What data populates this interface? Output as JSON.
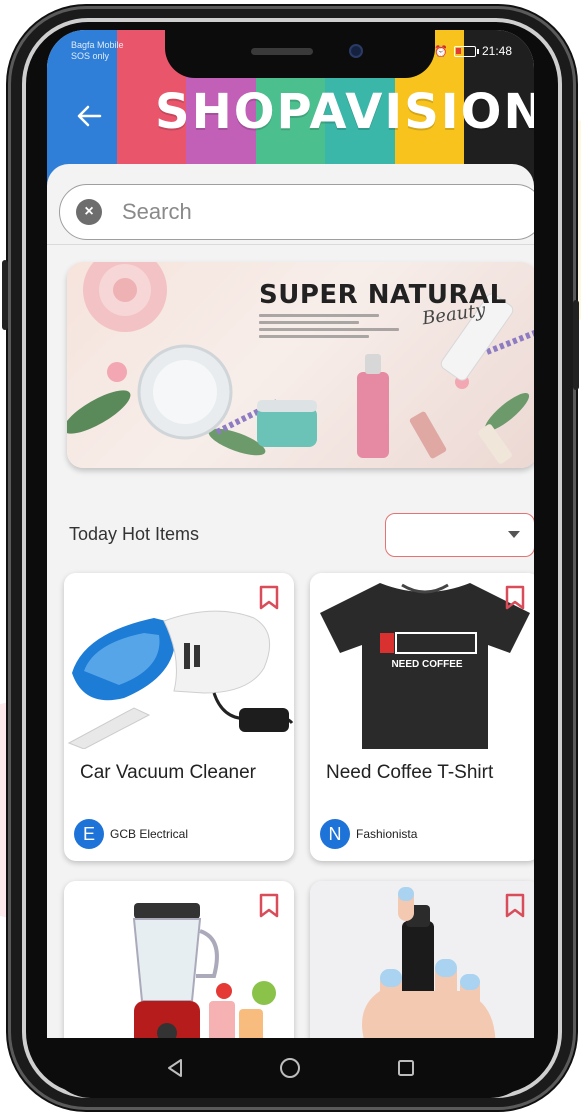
{
  "status_bar": {
    "carrier_line1": "Bagfa Mobile",
    "carrier_line2": "SOS only",
    "time": "21:48"
  },
  "header": {
    "brand": "SHOPAVISION",
    "stripe_colors": [
      "#2f7fd8",
      "#e9566b",
      "#c25fb7",
      "#4cbf8f",
      "#3ab7a8",
      "#f7c31c",
      "#1f1f1f"
    ],
    "back_icon": "arrow-left-icon"
  },
  "search": {
    "placeholder": "Search",
    "value": "",
    "clear_icon": "close-circle-icon"
  },
  "banner": {
    "title": "SUPER NATURAL",
    "script": "Beauty"
  },
  "section": {
    "title": "Today Hot Items",
    "dropdown_value": ""
  },
  "products": [
    {
      "name": "Car Vacuum Cleaner",
      "seller_initial": "E",
      "seller_name": "GCB Electrical"
    },
    {
      "name": "Need Coffee T-Shirt",
      "seller_initial": "N",
      "seller_name": "Fashionista",
      "shirt_text": "NEED COFFEE"
    },
    {
      "name": "",
      "seller_initial": "",
      "seller_name": ""
    },
    {
      "name": "",
      "seller_initial": "",
      "seller_name": ""
    }
  ],
  "colors": {
    "accent_red": "#d94d5a",
    "avatar_blue": "#1e73d8"
  },
  "navbar": {
    "back_icon": "triangle-back-icon",
    "home_icon": "circle-home-icon",
    "recents_icon": "square-recents-icon"
  }
}
